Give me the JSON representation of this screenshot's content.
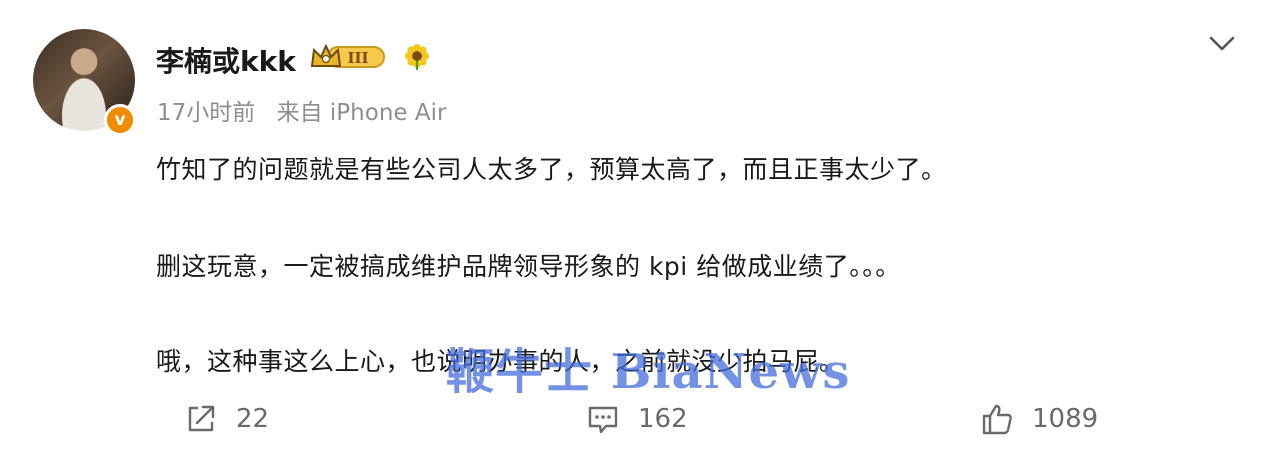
{
  "post": {
    "username": "李楠或kkk",
    "level_badge": "III",
    "verified_mark": "v",
    "time": "17小时前",
    "source": "来自 iPhone Air",
    "paragraphs": [
      "竹知了的问题就是有些公司人太多了，预算太高了，而且正事太少了。",
      "删这玩意，一定被搞成维护品牌领导形象的 kpi 给做成业绩了。。。",
      "哦，这种事这么上心，也说明办事的人，之前就没少拍马屁。"
    ],
    "watermark": "鞭牛士 BiaNews"
  },
  "actions": {
    "share_count": "22",
    "comment_count": "162",
    "like_count": "1089"
  },
  "icons": [
    "crown-badge-icon",
    "sunflower-icon",
    "chevron-down-icon",
    "share-icon",
    "comment-icon",
    "like-icon"
  ],
  "colors": {
    "meta_text": "#8e8e8e",
    "badge_orange": "#f08c00",
    "watermark_blue": "#466edc"
  }
}
